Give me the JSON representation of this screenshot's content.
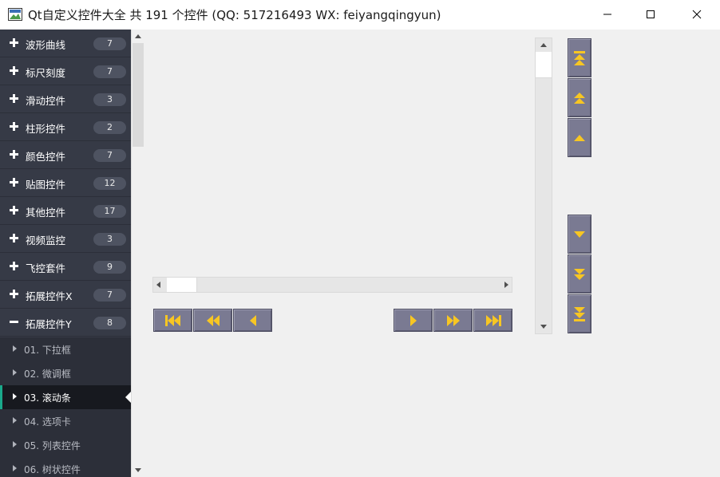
{
  "window": {
    "title": "Qt自定义控件大全 共 191 个控件 (QQ: 517216493 WX: feiyangqingyun)",
    "minimize_icon": "minimize-icon",
    "maximize_icon": "maximize-icon",
    "close_icon": "close-icon"
  },
  "sidebar": {
    "groups": [
      {
        "label": "波形曲线",
        "count": "7",
        "expanded": false
      },
      {
        "label": "标尺刻度",
        "count": "7",
        "expanded": false
      },
      {
        "label": "滑动控件",
        "count": "3",
        "expanded": false
      },
      {
        "label": "柱形控件",
        "count": "2",
        "expanded": false
      },
      {
        "label": "颜色控件",
        "count": "7",
        "expanded": false
      },
      {
        "label": "贴图控件",
        "count": "12",
        "expanded": false
      },
      {
        "label": "其他控件",
        "count": "17",
        "expanded": false
      },
      {
        "label": "视频监控",
        "count": "3",
        "expanded": false
      },
      {
        "label": "飞控套件",
        "count": "9",
        "expanded": false
      },
      {
        "label": "拓展控件X",
        "count": "7",
        "expanded": false
      },
      {
        "label": "拓展控件Y",
        "count": "8",
        "expanded": true
      }
    ],
    "children": [
      {
        "label": "01. 下拉框",
        "active": false
      },
      {
        "label": "02. 微调框",
        "active": false
      },
      {
        "label": "03. 滚动条",
        "active": true
      },
      {
        "label": "04. 选项卡",
        "active": false
      },
      {
        "label": "05. 列表控件",
        "active": false
      },
      {
        "label": "06. 树状控件",
        "active": false
      }
    ]
  },
  "main": {
    "horizontal_buttons": [
      "first-icon",
      "page-prev-icon",
      "prev-icon",
      "next-icon",
      "page-next-icon",
      "last-icon"
    ],
    "vertical_buttons": [
      "top-icon",
      "page-up-icon",
      "up-icon",
      "down-icon",
      "page-down-icon",
      "bottom-icon"
    ]
  },
  "colors": {
    "sidebar_bg": "#363a46",
    "sidebar_child_bg": "#2c2f39",
    "active_child_bg": "#17191f",
    "accent": "#1aa98b",
    "button_face": "#7a7a92",
    "button_icon": "#f7c623"
  }
}
